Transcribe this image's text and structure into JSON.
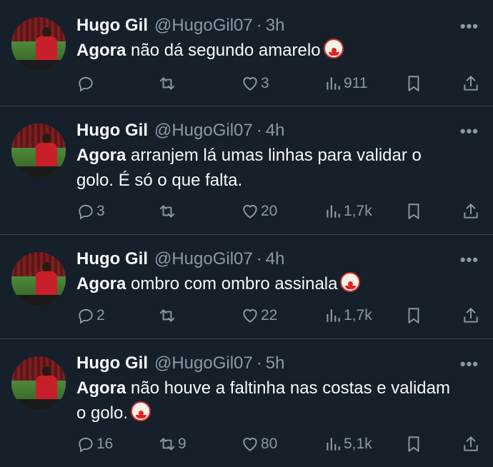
{
  "tweets": [
    {
      "name": "Hugo Gil",
      "handle": "@HugoGil07",
      "dot": "·",
      "time": "3h",
      "bold": "Agora",
      "rest": "não dá segundo amarelo",
      "clown": true,
      "replies": "",
      "retweets": "",
      "likes": "3",
      "views": "911"
    },
    {
      "name": "Hugo Gil",
      "handle": "@HugoGil07",
      "dot": "·",
      "time": "4h",
      "bold": "Agora",
      "rest": "arranjem lá umas linhas para validar o golo. É só o que falta.",
      "clown": false,
      "replies": "3",
      "retweets": "",
      "likes": "20",
      "views": "1,7k"
    },
    {
      "name": "Hugo Gil",
      "handle": "@HugoGil07",
      "dot": "·",
      "time": "4h",
      "bold": "Agora",
      "rest": "ombro com ombro assinala",
      "clown": true,
      "replies": "2",
      "retweets": "",
      "likes": "22",
      "views": "1,7k"
    },
    {
      "name": "Hugo Gil",
      "handle": "@HugoGil07",
      "dot": "·",
      "time": "5h",
      "bold": "Agora",
      "rest": "não houve a faltinha nas costas e validam o golo.",
      "clown": true,
      "replies": "16",
      "retweets": "9",
      "likes": "80",
      "views": "5,1k"
    }
  ],
  "icons": {
    "reply": "reply-icon",
    "retweet": "retweet-icon",
    "like": "heart-icon",
    "views": "views-icon",
    "bookmark": "bookmark-icon",
    "share": "share-icon",
    "more": "more-icon",
    "clown": "clown-emoji-icon"
  },
  "colors": {
    "background": "#15202b",
    "text": "#f7f9f9",
    "secondary": "#8b98a5",
    "divider": "#38444d"
  }
}
